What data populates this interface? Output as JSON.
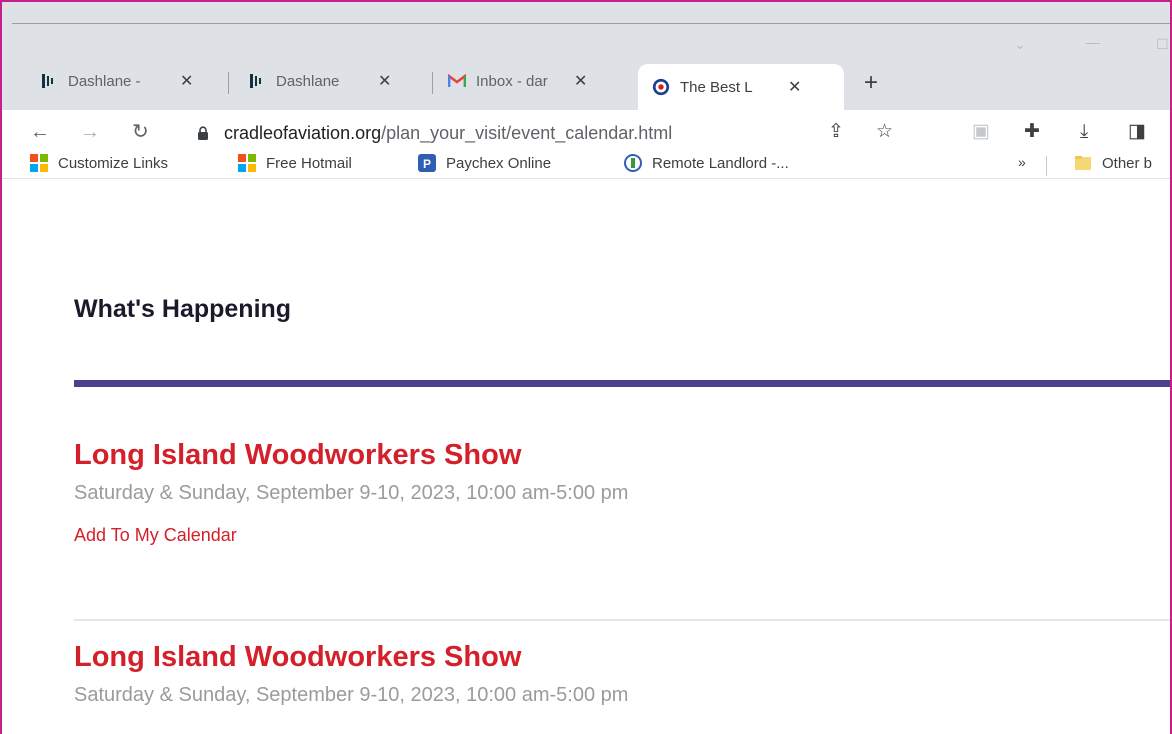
{
  "browser": {
    "tabs": [
      {
        "label": "Dashlane -",
        "icon": "dashlane-icon"
      },
      {
        "label": "Dashlane",
        "icon": "dashlane-icon"
      },
      {
        "label": "Inbox - dar",
        "icon": "gmail-icon"
      },
      {
        "label": "The Best L",
        "icon": "site-icon"
      }
    ],
    "new_tab_label": "+",
    "url_domain": "cradleofaviation.org",
    "url_path": "/plan_your_visit/event_calendar.html",
    "bookmarks": [
      {
        "label": "Customize Links",
        "icon": "windows-icon"
      },
      {
        "label": "Free Hotmail",
        "icon": "windows-icon"
      },
      {
        "label": "Paychex Online",
        "icon": "paychex-icon"
      },
      {
        "label": "Remote Landlord -...",
        "icon": "remote-landlord-icon"
      }
    ],
    "overflow_label": "»",
    "other_bookmarks_label": "Other b"
  },
  "page": {
    "heading": "What's Happening",
    "events": [
      {
        "title": "Long Island Woodworkers Show",
        "date": "Saturday & Sunday, September 9-10, 2023, 10:00 am-5:00 pm",
        "calendar_link": "Add To My Calendar"
      },
      {
        "title": "Long Island Woodworkers Show",
        "date": "Saturday & Sunday, September 9-10, 2023, 10:00 am-5:00 pm"
      }
    ]
  },
  "colors": {
    "accent_red": "#d4202a",
    "rule_purple": "#4b3f8f",
    "frame_magenta": "#c3208a"
  }
}
